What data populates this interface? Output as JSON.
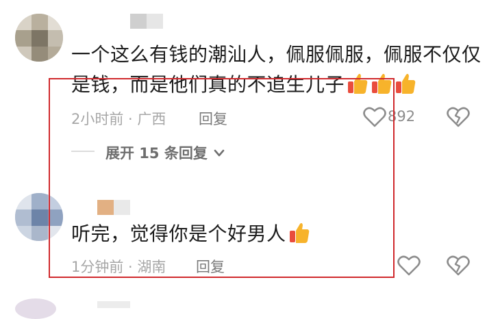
{
  "comments": [
    {
      "text_line1": "一个这么有钱的潮汕人，佩服佩服，佩服不仅仅",
      "text_line2": "是钱，而是他们真的不追生儿子",
      "emoji": "thumbs-up-icon",
      "emoji_count": 3,
      "time": "2小时前",
      "location": "广西",
      "reply_label": "回复",
      "likes": "892",
      "expand_label": "展开 15 条回复"
    },
    {
      "text_line1": "听完，觉得你是个好男人",
      "emoji": "thumbs-up-icon",
      "emoji_count": 1,
      "time": "1分钟前",
      "location": "湖南",
      "reply_label": "回复"
    }
  ],
  "colors": {
    "highlight_border": "#d0282c",
    "thumb_fill": "#f7b32b",
    "thumb_cuff": "#e94c3d",
    "muted_text": "#a6a6a6"
  }
}
